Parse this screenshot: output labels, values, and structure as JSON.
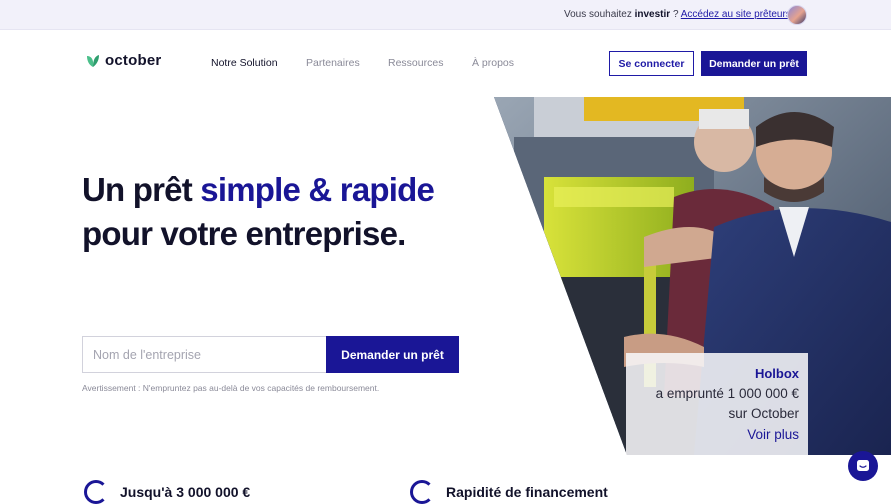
{
  "topbar": {
    "prefix": "Vous souhaitez ",
    "prefix_bold": "investir",
    "suffix": " ? ",
    "link": "Accédez au site prêteurs"
  },
  "brand": {
    "name": "october",
    "accent": "#1a1696",
    "logo_green": "#4bbf8a"
  },
  "nav": {
    "items": [
      {
        "label": "Notre Solution",
        "active": true
      },
      {
        "label": "Partenaires",
        "active": false
      },
      {
        "label": "Ressources",
        "active": false
      },
      {
        "label": "À propos",
        "active": false
      }
    ],
    "login": "Se connecter",
    "cta": "Demander un prêt"
  },
  "hero": {
    "title_part1": "Un prêt ",
    "title_accent": "simple & rapide",
    "title_part2": "pour votre entreprise.",
    "input_placeholder": "Nom de l'entreprise",
    "button": "Demander un prêt",
    "disclaimer": "Avertissement : N'empruntez pas au-delà de vos capacités de remboursement."
  },
  "testimonial": {
    "company": "Holbox",
    "line1": "a emprunté 1 000 000 €",
    "line2": "sur October",
    "link": "Voir plus"
  },
  "features": [
    {
      "label": "Jusqu'à 3 000 000 €",
      "icon": "check-circle-icon"
    },
    {
      "label": "Rapidité de financement",
      "icon": "check-circle-icon"
    }
  ],
  "chat": {
    "icon": "chat-icon"
  }
}
